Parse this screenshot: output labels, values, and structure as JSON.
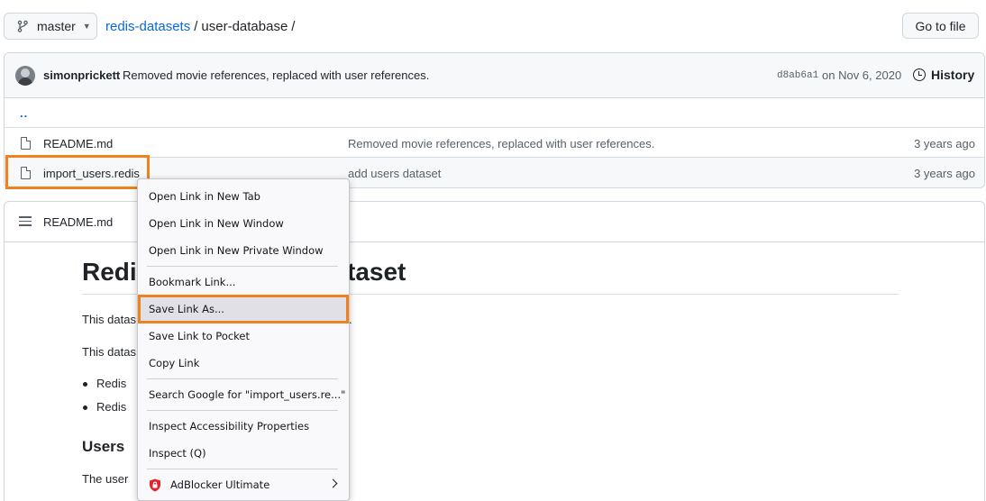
{
  "header": {
    "branch_label": "master",
    "breadcrumb_repo": "redis-datasets",
    "breadcrumb_sep1": "/",
    "breadcrumb_folder": "user-database",
    "breadcrumb_sep2": "/",
    "goto_file_label": "Go to file"
  },
  "commit": {
    "author": "simonprickett",
    "message": "Removed movie references, replaced with user references.",
    "hash": "d8ab6a1",
    "date": "on Nov 6, 2020",
    "history_label": "History"
  },
  "files": {
    "parent_link": "..",
    "rows": [
      {
        "name": "README.md",
        "message": "Removed movie references, replaced with user references.",
        "age": "3 years ago"
      },
      {
        "name": "import_users.redis",
        "message": "add users dataset",
        "age": "3 years ago"
      }
    ]
  },
  "readme": {
    "title": "README.md",
    "h1_start": "Redi",
    "h1_end": "taset",
    "p1_start": "This datas",
    "p1_end": ".",
    "p2_start": "This datas",
    "li1": "Redis",
    "li2": "Redis",
    "h2": "Users",
    "p3_start": "The user"
  },
  "context_menu": {
    "items": [
      {
        "label": "Open Link in New Tab"
      },
      {
        "label": "Open Link in New Window"
      },
      {
        "label": "Open Link in New Private Window"
      },
      {
        "label": "Bookmark Link..."
      },
      {
        "label": "Save Link As..."
      },
      {
        "label": "Save Link to Pocket"
      },
      {
        "label": "Copy Link"
      },
      {
        "label": "Search Google for \"import_users.re...\""
      },
      {
        "label": "Inspect Accessibility Properties"
      },
      {
        "label": "Inspect (Q)"
      },
      {
        "label": "AdBlocker Ultimate"
      }
    ]
  },
  "colors": {
    "link": "#0969da",
    "highlight_outline": "#f0821d",
    "adblocker_shield": "#e0252f"
  },
  "icons": {
    "branch": "git-branch-icon",
    "history": "clock-icon",
    "file": "file-icon",
    "readme_toc": "list-icon",
    "adblocker": "shield-icon",
    "submenu": "chevron-right-icon"
  }
}
